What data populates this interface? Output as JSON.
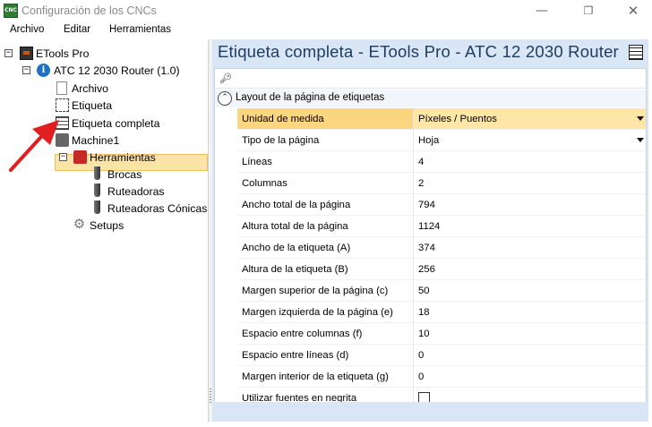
{
  "window": {
    "app_icon_text": "CNC",
    "title": "Configuración de los CNCs",
    "minimize_glyph": "—",
    "maximize_glyph": "❐",
    "close_glyph": "✕"
  },
  "menu": {
    "items": [
      "Archivo",
      "Editar",
      "Herramientas"
    ]
  },
  "tree": {
    "expand_collapsed": "−",
    "nodes": [
      {
        "label": "ETools Pro",
        "icon": "cnc-machine-icon",
        "expander": "−"
      },
      {
        "label": "ATC 12 2030 Router (1.0)",
        "icon": "info-icon",
        "expander": "−"
      },
      {
        "label": "Archivo",
        "icon": "document-icon"
      },
      {
        "label": "Etiqueta",
        "icon": "label-icon"
      },
      {
        "label": "Etiqueta completa",
        "icon": "label-sheet-icon",
        "selected": true
      },
      {
        "label": "Machine1",
        "icon": "machine-icon"
      },
      {
        "label": "Herramientas",
        "icon": "toolbox-icon",
        "expander": "−"
      },
      {
        "label": "Brocas",
        "icon": "drill-bit-icon"
      },
      {
        "label": "Ruteadoras",
        "icon": "router-bit-icon"
      },
      {
        "label": "Ruteadoras Cónicas",
        "icon": "conical-bit-icon"
      },
      {
        "label": "Setups",
        "icon": "gear-icon"
      }
    ]
  },
  "panel": {
    "title": "Etiqueta completa - ETools Pro - ATC 12 2030 Router",
    "search": {
      "value": "",
      "placeholder": ""
    },
    "category": {
      "label": "Layout de la página de etiquetas",
      "toggle_glyph": "⌃"
    },
    "properties": [
      {
        "name": "Unidad de medida",
        "value": "Píxeles / Puentos",
        "dropdown": true,
        "selected": true
      },
      {
        "name": "Tipo de la página",
        "value": "Hoja",
        "dropdown": true
      },
      {
        "name": "Líneas",
        "value": "4"
      },
      {
        "name": "Columnas",
        "value": "2"
      },
      {
        "name": "Ancho total de la página",
        "value": "794"
      },
      {
        "name": "Altura total de la página",
        "value": "1124"
      },
      {
        "name": "Ancho de la etiqueta (A)",
        "value": "374"
      },
      {
        "name": "Altura de la etiqueta (B)",
        "value": "256"
      },
      {
        "name": "Margen superior de la página (c)",
        "value": "50"
      },
      {
        "name": "Margen izquierda de la página (e)",
        "value": "18"
      },
      {
        "name": "Espacio entre columnas (f)",
        "value": "10"
      },
      {
        "name": "Espacio entre líneas (d)",
        "value": "0"
      },
      {
        "name": "Margen interior de la etiqueta (g)",
        "value": "0"
      },
      {
        "name": "Utilizar fuentes en negrita",
        "value": "",
        "checkbox": true,
        "checked": false
      }
    ]
  },
  "colors": {
    "selection_fill": "#fde3a7",
    "header_bg": "#d8e6f5",
    "arrow_red": "#e02020"
  }
}
